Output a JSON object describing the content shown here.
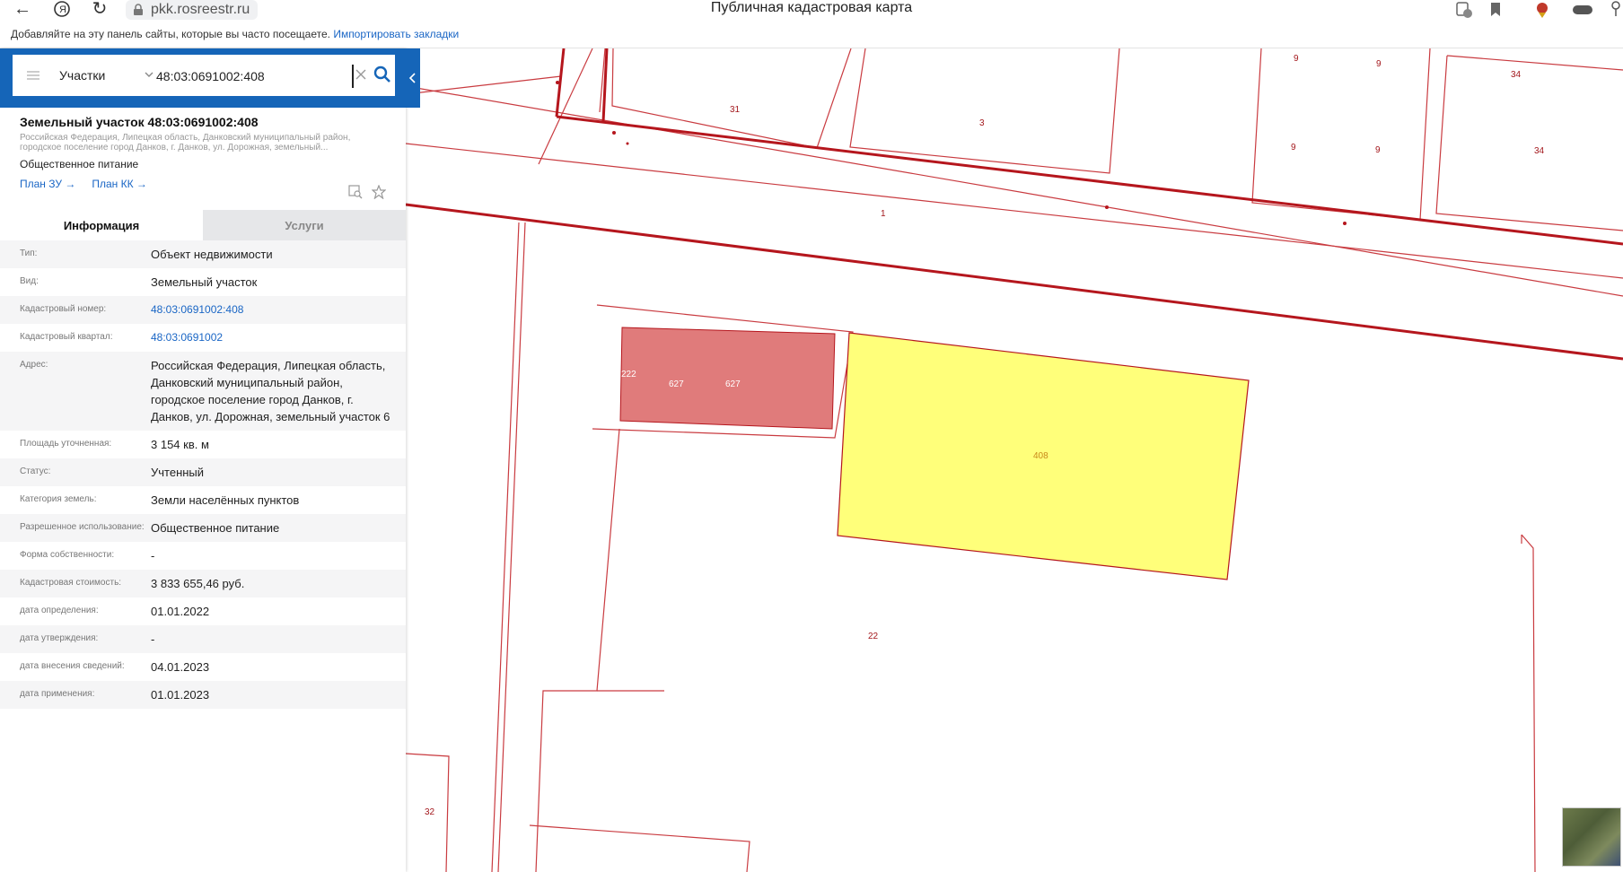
{
  "browser": {
    "url": "pkk.rosreestr.ru",
    "page_title": "Публичная кадастровая карта",
    "bookmarks_hint": "Добавляйте на эту панель сайты, которые вы часто посещаете.",
    "import_link": "Импортировать закладки"
  },
  "search": {
    "layer": "Участки",
    "query": "48:03:0691002:408"
  },
  "object": {
    "title": "Земельный участок 48:03:0691002:408",
    "address_short": "Российская Федерация, Липецкая область, Данковский муниципальный район, городское поселение город Данков, г. Данков, ул. Дорожная, земельный...",
    "use": "Общественное питание",
    "link_plan_zu": "План ЗУ →",
    "link_plan_kk": "План КК →"
  },
  "tabs": {
    "info": "Информация",
    "services": "Услуги"
  },
  "rows": [
    {
      "key": "Тип:",
      "value": "Объект недвижимости"
    },
    {
      "key": "Вид:",
      "value": "Земельный участок"
    },
    {
      "key": "Кадастровый номер:",
      "value": "48:03:0691002:408"
    },
    {
      "key": "Кадастровый квартал:",
      "value": "48:03:0691002"
    },
    {
      "key": "Адрес:",
      "value": "Российская Федерация, Липецкая область, Данковский муниципальный район, городское поселение город Данков, г. Данков, ул. Дорожная, земельный участок 6"
    },
    {
      "key": "Площадь уточненная:",
      "value": "3 154 кв. м"
    },
    {
      "key": "Статус:",
      "value": "Учтенный"
    },
    {
      "key": "Категория земель:",
      "value": "Земли населённых пунктов"
    },
    {
      "key": "Разрешенное использование:",
      "value": "Общественное питание"
    },
    {
      "key": "Форма собственности:",
      "value": "-"
    },
    {
      "key": "Кадастровая стоимость:",
      "value": "3 833 655,46 руб."
    },
    {
      "key": "дата определения:",
      "value": "01.01.2022"
    },
    {
      "key": "дата утверждения:",
      "value": "-"
    },
    {
      "key": "дата внесения сведений:",
      "value": "04.01.2023"
    },
    {
      "key": "дата применения:",
      "value": "01.01.2023"
    }
  ],
  "map_labels": {
    "l31": "31",
    "l3": "3",
    "l9a": "9",
    "l9b": "9",
    "l9c": "9",
    "l9d": "9",
    "l34a": "34",
    "l34b": "34",
    "l1": "1",
    "l222": "222",
    "l627a": "627",
    "l627b": "627",
    "l408": "408",
    "l22": "22",
    "l32": "32"
  },
  "colors": {
    "brand_blue": "#1565b8",
    "parcel_line": "#b5161d",
    "selected_fill": "#ffff7a",
    "building_fill": "#e07b7b"
  }
}
